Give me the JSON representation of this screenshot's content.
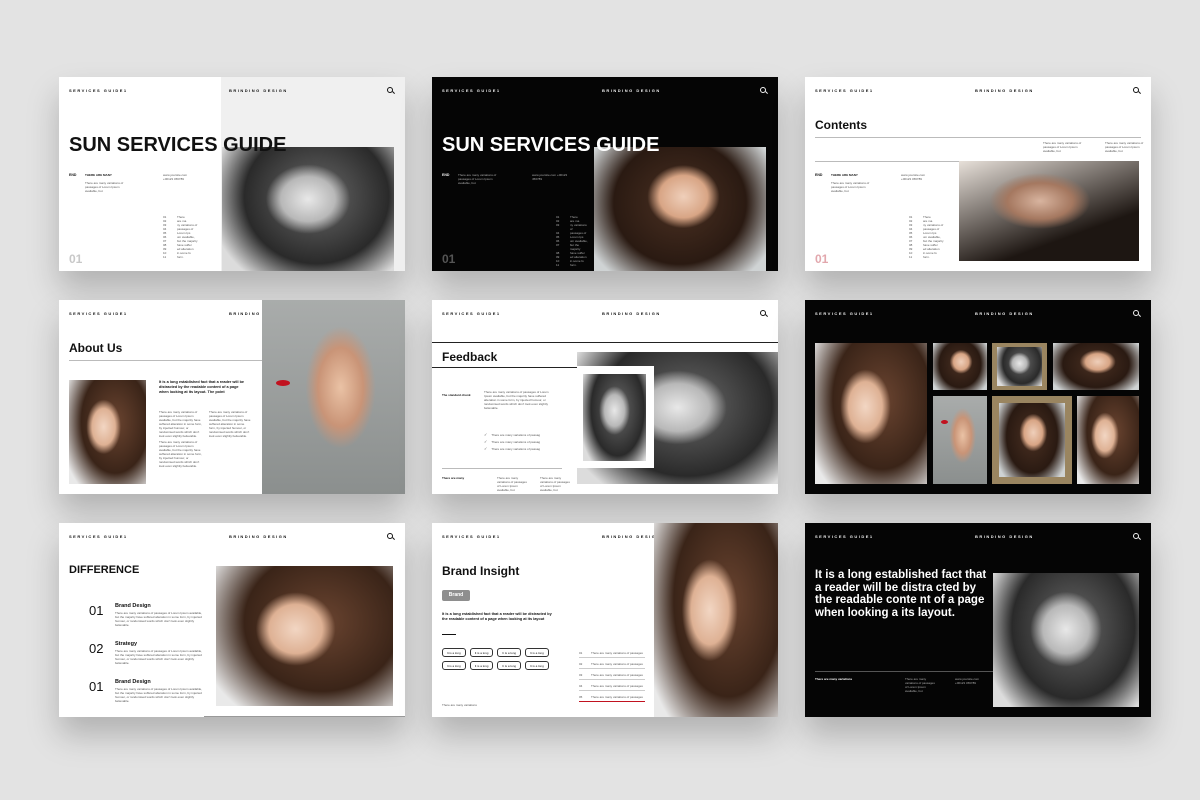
{
  "common": {
    "header_left": "SERVICES GUIDE1",
    "header_center": "BRINDING DESIGN",
    "placeholder_short": "There are many variations of passages of Lorem Ipsum available, but",
    "placeholder_long": "There are many variations of passages of Lorem Ipsum available, but the majority have suffered alteration in some form, by injected humour, or randomised words which don't look even slightly believable."
  },
  "slide1": {
    "title": "SUN  SERVICES GUIDE",
    "end_label": "END",
    "end_sub": "THERE ARE MANY",
    "contact": "www.yoursite.com\n+00123 456789",
    "list": [
      "There",
      "are ma",
      "ny variations of",
      "passages of",
      "Lorem Ips",
      "um available,",
      "but the majority",
      "have suffer",
      "ed alteration",
      "in some fo",
      "form."
    ],
    "page_num": "01"
  },
  "slide2": {
    "title": "SUN  SERVICES GUIDE",
    "end_label": "END",
    "page_num": "01"
  },
  "slide3": {
    "title": "Contents",
    "end_label": "END",
    "end_sub": "THERE ARE MANY",
    "page_num": "01"
  },
  "slide4": {
    "title": "About Us",
    "lead": "It is a long established fact that a reader will be distracted by the readable content of a page when looking at its layout. The point"
  },
  "slide5": {
    "title": "Feedback",
    "label": "The standard chunk",
    "checks": [
      "There are many variations of passag",
      "There are many variations of passag",
      "There are many variations of passag"
    ],
    "footer_label": "There are many"
  },
  "slide7": {
    "title": "DIFFERENCE",
    "items": [
      {
        "num": "01",
        "title": "Brand Design"
      },
      {
        "num": "02",
        "title": "Strategy"
      },
      {
        "num": "01",
        "title": "Brand Design"
      }
    ]
  },
  "slide8": {
    "title": "Brand Insight",
    "badge": "Brand",
    "lead": "It is a long established fact that a reader will be distracted by the readable content of a page when looking at its layout",
    "pills": [
      "It is a long",
      "It is a long",
      "It is a long",
      "It is a long",
      "It is a long",
      "It is a long",
      "It is a long",
      "It is a long"
    ],
    "rows": [
      "There are many variations of passages",
      "There are many variations of passages",
      "There are many variations of passages",
      "There are many variations of passages",
      "There are many variations of passages"
    ],
    "footer": "There are many variations"
  },
  "slide9": {
    "quote": "It is a long established fact that a reader will be distra cted by the readable conte nt of a page when looking a its layout.",
    "footer_label": "There are many variations"
  },
  "colors": {
    "accent_red": "#c1121f",
    "dark": "#050505",
    "badge": "#8e8e8e",
    "frame_gold": "#9a8560"
  }
}
